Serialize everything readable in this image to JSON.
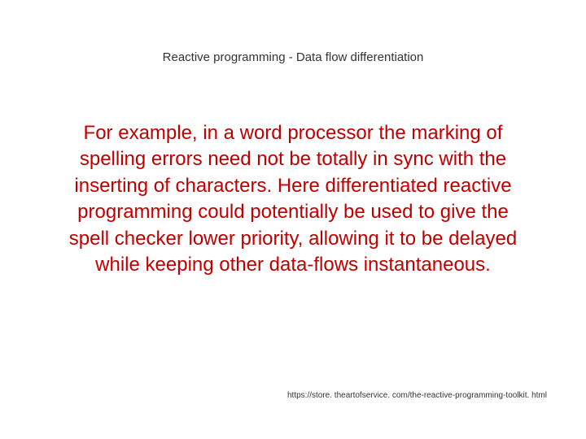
{
  "title": "Reactive programming -  Data flow differentiation",
  "body": "For example, in a word processor the marking of spelling errors need not be totally in sync with the inserting of characters. Here differentiated reactive programming could potentially be used to give the spell checker lower priority, allowing it to be delayed while keeping other data-flows instantaneous.",
  "footer": "https://store. theartofservice. com/the-reactive-programming-toolkit. html"
}
